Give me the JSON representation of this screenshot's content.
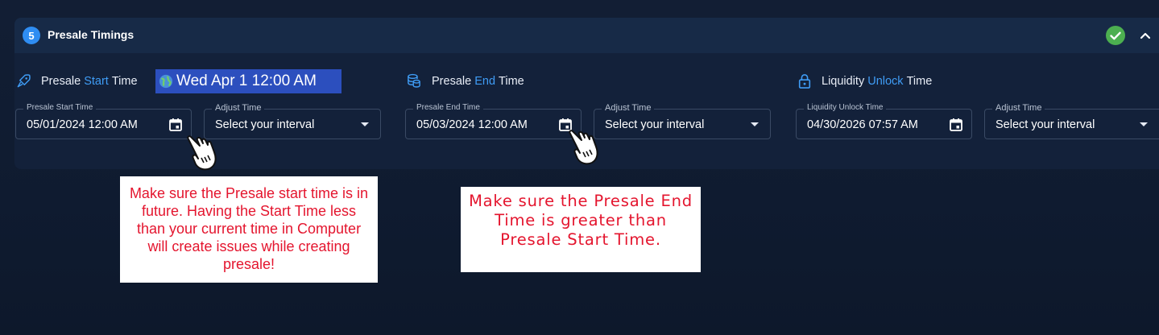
{
  "section": {
    "step_number": "5",
    "title": "Presale Timings",
    "status_icon": "check-circle-icon",
    "collapse_icon": "chevron-up-icon",
    "accent_color": "#3f9cf5",
    "status_color": "#4caf50"
  },
  "start": {
    "label_prefix": "Presale ",
    "label_highlight": "Start",
    "label_suffix": " Time",
    "icon": "rocket-icon",
    "field_legend": "Presale Start Time",
    "field_value": "05/01/2024 12:00 AM",
    "adjust_legend": "Adjust Time",
    "adjust_value": "Select your interval"
  },
  "end": {
    "label_prefix": "Presale ",
    "label_highlight": "End",
    "label_suffix": " Time",
    "icon": "coins-icon",
    "field_legend": "Presale End Time",
    "field_value": "05/03/2024 12:00 AM",
    "adjust_legend": "Adjust Time",
    "adjust_value": "Select your interval"
  },
  "unlock": {
    "label_prefix": "Liquidity ",
    "label_highlight": "Unlock",
    "label_suffix": " Time",
    "icon": "lock-icon",
    "field_legend": "Liquidity Unlock Time",
    "field_value": "04/30/2026 07:57 AM",
    "adjust_legend": "Adjust Time",
    "adjust_value": "Select your interval"
  },
  "tooltip": {
    "text": "Wed Apr 1 12:00 AM",
    "icon": "globe-icon"
  },
  "notes": {
    "start_note": "Make sure the Presale start time is in future. Having the Start Time less than your current time in Computer will create issues while creating presale!",
    "end_note": "Make sure the Presale End Time is greater than Presale Start Time."
  }
}
